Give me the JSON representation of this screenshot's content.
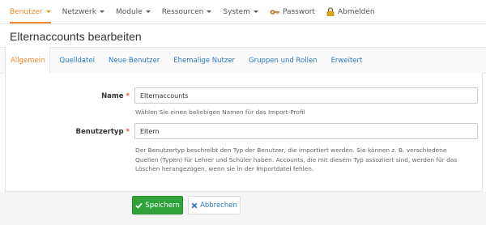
{
  "nav": {
    "items": [
      {
        "label": "Benutzer",
        "dropdown": true,
        "active": true
      },
      {
        "label": "Netzwerk",
        "dropdown": true
      },
      {
        "label": "Module",
        "dropdown": true
      },
      {
        "label": "Ressourcen",
        "dropdown": true
      },
      {
        "label": "System",
        "dropdown": true
      },
      {
        "label": "Passwort",
        "icon": "key-icon"
      },
      {
        "label": "Abmelden",
        "icon": "lock-icon"
      }
    ]
  },
  "page": {
    "title": "Elternaccounts bearbeiten"
  },
  "tabs": [
    {
      "label": "Allgemein",
      "active": true
    },
    {
      "label": "Quelldatei"
    },
    {
      "label": "Neue Benutzer"
    },
    {
      "label": "Ehemalige Nutzer"
    },
    {
      "label": "Gruppen und Rollen"
    },
    {
      "label": "Erweitert"
    }
  ],
  "form": {
    "name": {
      "label": "Name",
      "required_mark": "*",
      "value": "Elternaccounts",
      "help": "Wählen Sie einen beliebigen Namen für das Import-Profil"
    },
    "usertype": {
      "label": "Benutzertyp",
      "required_mark": "*",
      "value": "Eltern",
      "help_lines": [
        "Der Benutzertyp beschreibt den Typ der Benutzer, die importiert werden. Sie können z. B. verschiedene",
        "Quellen (Typen) für Lehrer und Schüler haben. Accounts, die mit diesem Typ assoziiert sind, werden für das",
        "Löschen herangezogen, wenn sie in der Importdatei fehlen."
      ]
    }
  },
  "buttons": {
    "save": "Speichern",
    "cancel": "Abbrechen"
  },
  "colors": {
    "accent": "#f0892b",
    "link": "#2a7ac2",
    "save": "#2fa33a",
    "required": "#e74c3c"
  }
}
